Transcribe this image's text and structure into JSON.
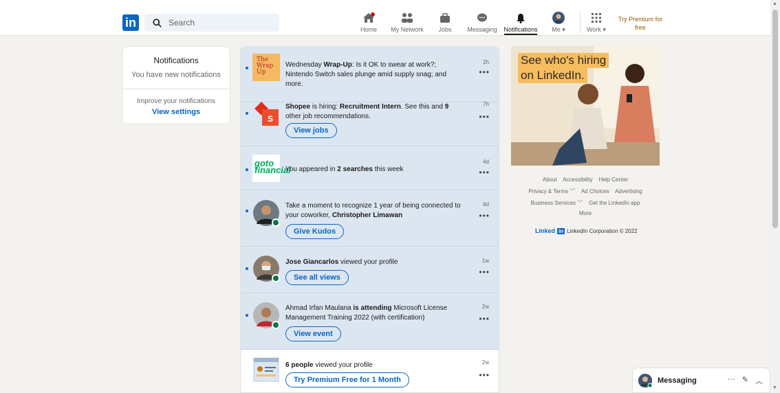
{
  "nav": {
    "logo": "in",
    "search_placeholder": "Search",
    "items": [
      {
        "label": "Home"
      },
      {
        "label": "My Network"
      },
      {
        "label": "Jobs"
      },
      {
        "label": "Messaging"
      },
      {
        "label": "Notifications"
      },
      {
        "label": "Me ▾"
      },
      {
        "label": "Work ▾"
      }
    ],
    "premium_line1": "Try Premium for",
    "premium_line2": "free"
  },
  "left_card": {
    "title": "Notifications",
    "subtitle": "You have new notifications",
    "improve": "Improve your notifications",
    "settings_link": "View settings"
  },
  "notifications": [
    {
      "pre": "Wednesday ",
      "bold": "Wrap-Up",
      "post": ": Is it OK to swear at work?; Nintendo Switch sales plunge amid supply snag; and more.",
      "time": "2h",
      "thumb_text": "The Wrap Up"
    },
    {
      "pre": "",
      "bold": "Shopee",
      "post": " is hiring: ",
      "bold2": "Recruitment Intern",
      "post2": ". See this and ",
      "bold3": "9",
      "post3": " other job recommendations.",
      "time": "7h",
      "button": "View jobs"
    },
    {
      "pre": "You appeared in ",
      "bold": "2 searches",
      "post": " this week",
      "time": "4d",
      "thumb_text": "goto financial"
    },
    {
      "pre": "Take a moment to recognize 1 year of being connected to your coworker, ",
      "bold": "Christopher Limawan",
      "post": "",
      "time": "6d",
      "button": "Give Kudos"
    },
    {
      "pre": "",
      "bold": "Jose Giancarlos",
      "post": " viewed your profile",
      "time": "1w",
      "button": "See all views"
    },
    {
      "pre": "Ahmad Irfan Maulana ",
      "bold": "is attending",
      "post": " Microsoft License Management Training 2022 (with certification)",
      "time": "2w",
      "button": "View event"
    },
    {
      "pre": "",
      "bold": "6 people",
      "post": " viewed your profile",
      "time": "2w",
      "button": "Try Premium Free for 1 Month"
    }
  ],
  "ad": {
    "line1": "See who's hiring",
    "line2": "on LinkedIn."
  },
  "footer": {
    "row1": [
      "About",
      "Accessibility",
      "Help Center"
    ],
    "row2": [
      "Privacy & Terms ﹀",
      "Ad Choices",
      "Advertising"
    ],
    "row3": [
      "Business Services ﹀",
      "Get the LinkedIn app"
    ],
    "row4": [
      "More"
    ],
    "brand": "Linked",
    "brand_in": "in",
    "copyright": "LinkedIn Corporation © 2022"
  },
  "messaging": {
    "label": "Messaging",
    "actions": [
      "···",
      "✎",
      "︿"
    ]
  },
  "colors": {
    "accent": "#0a66c2",
    "unread_bg": "#dce6f1",
    "premium": "#915907"
  }
}
